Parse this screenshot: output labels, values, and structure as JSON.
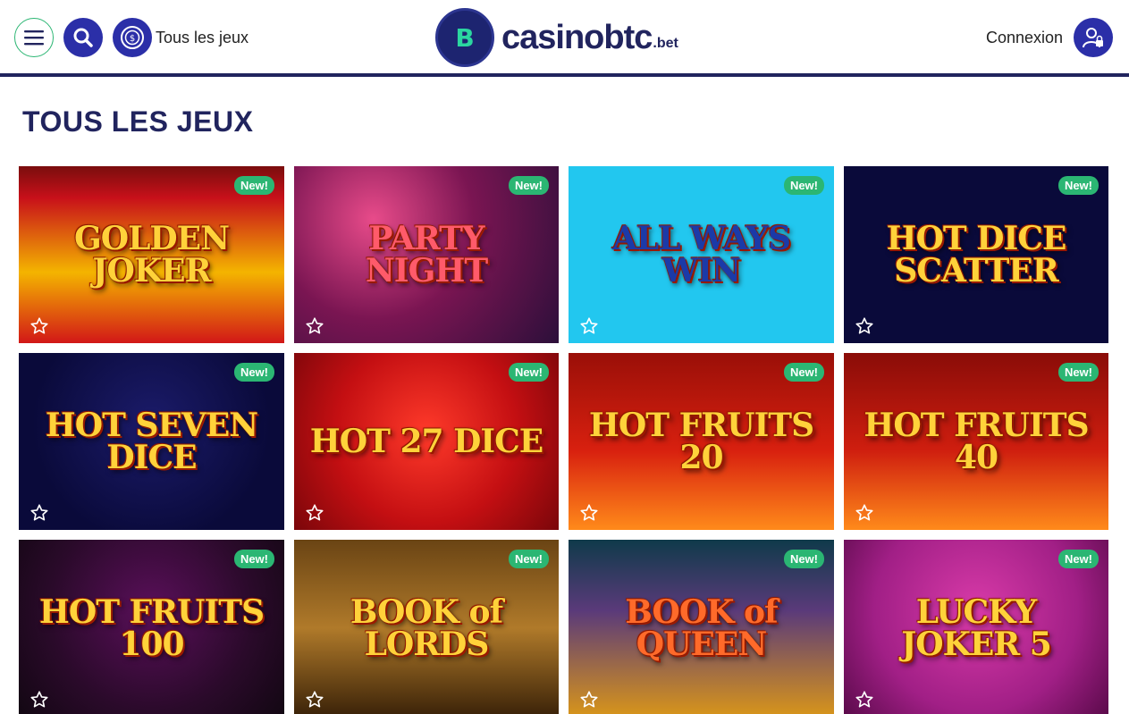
{
  "header": {
    "all_games_label": "Tous les jeux",
    "logo_text": "casinobtc",
    "logo_tld": ".bet",
    "login_label": "Connexion"
  },
  "page": {
    "title": "TOUS LES JEUX"
  },
  "badge_label": "New!",
  "games": [
    {
      "name": "GOLDEN JOKER",
      "bg": "linear-gradient(180deg,#7a0d0d 0%,#c8101a 18%,#f4b400 60%,#d21717 100%)",
      "color": "#ffd23a"
    },
    {
      "name": "PARTY NIGHT",
      "bg": "radial-gradient(circle at 30% 30%,#e84b8a 0%,#7a1552 45%,#2c0f3a 100%)",
      "color": "#ff5a6a"
    },
    {
      "name": "ALL WAYS WIN",
      "bg": "#22c7ef",
      "color": "#1b3aa8"
    },
    {
      "name": "HOT DICE SCATTER",
      "bg": "#0a0a3a",
      "color": "#ffd23a"
    },
    {
      "name": "HOT SEVEN DICE",
      "bg": "radial-gradient(circle at 50% 40%,#1b1b6a 0%,#0a0a3a 70%)",
      "color": "#ffd23a"
    },
    {
      "name": "HOT 27 DICE",
      "bg": "radial-gradient(circle at 50% 45%,#ff3a2a 0%,#c40f12 55%,#7a060a 100%)",
      "color": "#ffd23a"
    },
    {
      "name": "HOT FRUITS 20",
      "bg": "linear-gradient(180deg,#9a0f08 0%,#d8200f 55%,#ff8a1a 100%)",
      "color": "#ffd23a"
    },
    {
      "name": "HOT FRUITS 40",
      "bg": "linear-gradient(180deg,#8a0c08 0%,#cf1e0f 55%,#ff8a1a 100%)",
      "color": "#ffd23a"
    },
    {
      "name": "HOT FRUITS 100",
      "bg": "radial-gradient(circle at 50% 40%,#5a0f5a 0%,#2a0a2a 60%,#120712 100%)",
      "color": "#ffd23a"
    },
    {
      "name": "BOOK of LORDS",
      "bg": "linear-gradient(180deg,#6a4414 0%,#b07a2a 50%,#3a2208 100%)",
      "color": "#ffd23a"
    },
    {
      "name": "BOOK of QUEEN",
      "bg": "linear-gradient(180deg,#0f3a4a 0%,#5a3a7a 40%,#d8951a 100%)",
      "color": "#ff6a2a"
    },
    {
      "name": "LUCKY JOKER 5",
      "bg": "radial-gradient(circle at 50% 40%,#d83aa8 0%,#a11f86 60%,#5a0a4a 100%)",
      "color": "#ffd23a"
    }
  ]
}
